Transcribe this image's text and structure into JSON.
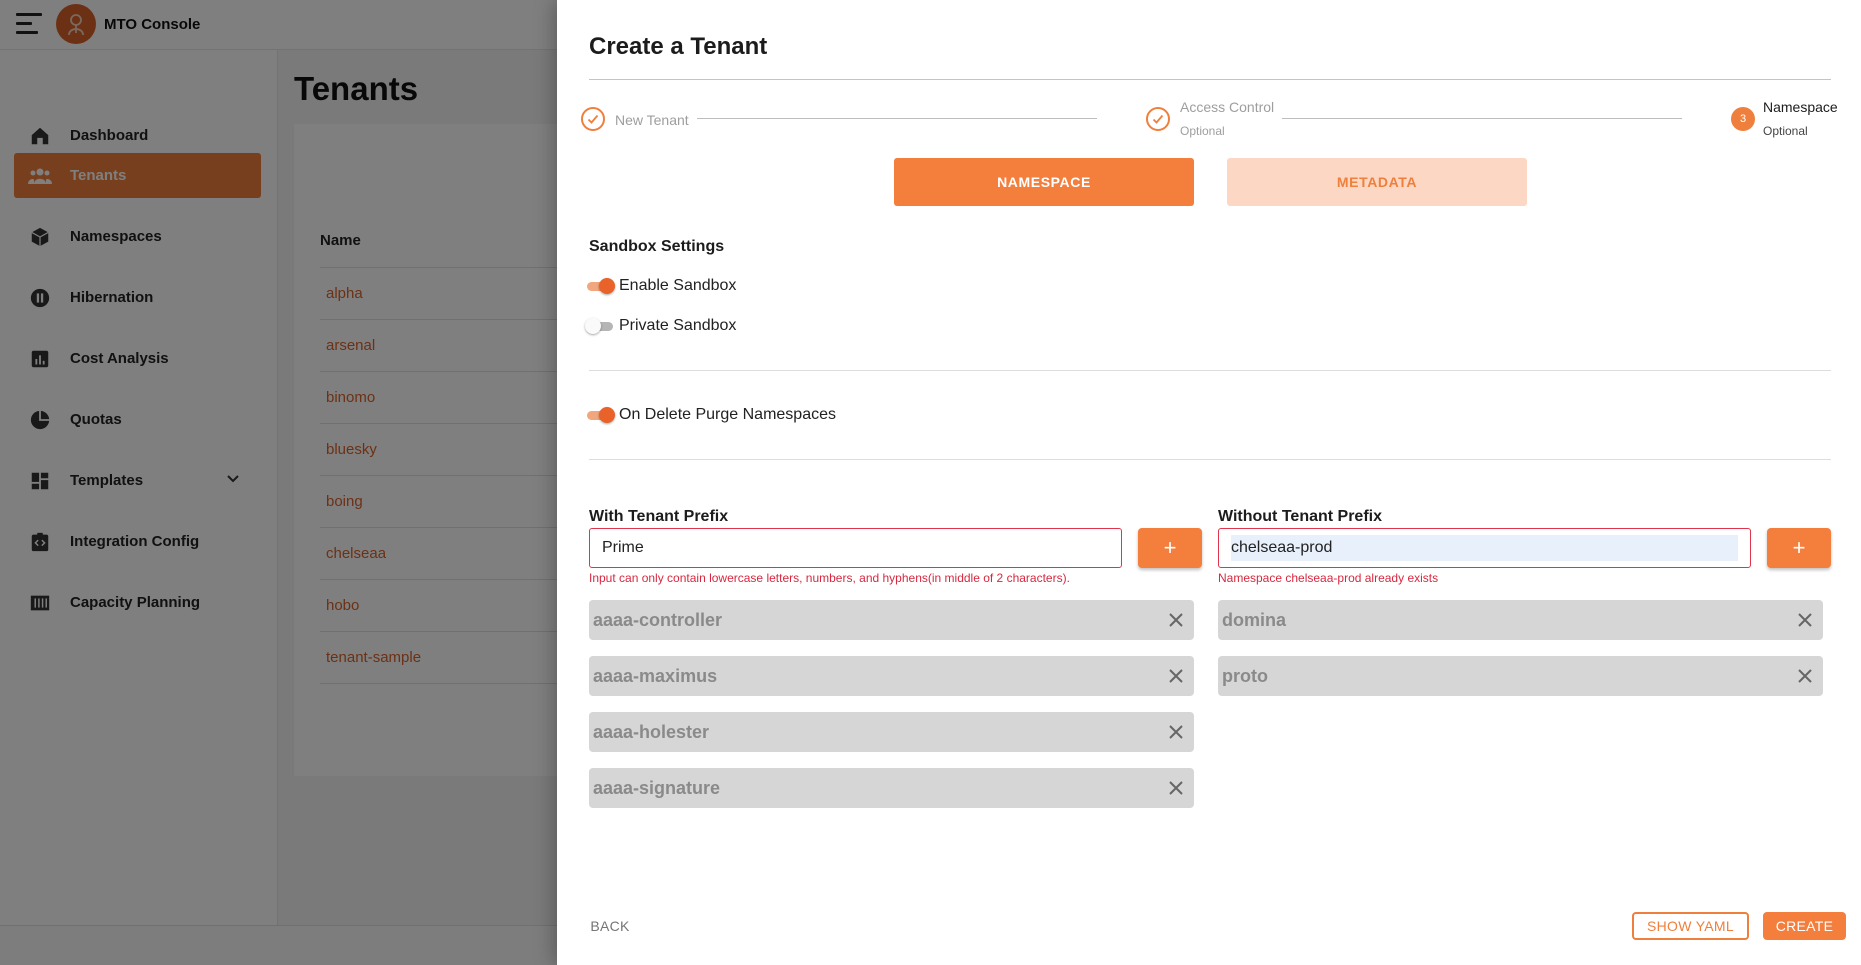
{
  "app": {
    "title": "MTO Console",
    "page_title": "Tenants",
    "sidebar": {
      "items": [
        {
          "label": "Dashboard",
          "icon": "home-icon"
        },
        {
          "label": "Tenants",
          "icon": "people-icon",
          "active": true
        },
        {
          "label": "Namespaces",
          "icon": "cube-icon"
        },
        {
          "label": "Hibernation",
          "icon": "pause-icon"
        },
        {
          "label": "Cost Analysis",
          "icon": "bar-chart-icon"
        },
        {
          "label": "Quotas",
          "icon": "pie-chart-icon"
        },
        {
          "label": "Templates",
          "icon": "dashboard-icon",
          "expandable": true
        },
        {
          "label": "Integration Config",
          "icon": "code-clipboard-icon"
        },
        {
          "label": "Capacity Planning",
          "icon": "columns-icon"
        }
      ]
    },
    "table": {
      "column_name": "Name",
      "rows": [
        "alpha",
        "arsenal",
        "binomo",
        "bluesky",
        "boing",
        "chelseaa",
        "hobo",
        "tenant-sample"
      ]
    }
  },
  "drawer": {
    "title": "Create a Tenant",
    "steps": [
      {
        "label": "New Tenant",
        "state": "done"
      },
      {
        "label": "Access Control",
        "sub": "Optional",
        "state": "done"
      },
      {
        "label": "Namespace",
        "sub": "Optional",
        "state": "active",
        "number": "3"
      }
    ],
    "tabs": {
      "namespace": "NAMESPACE",
      "metadata": "METADATA"
    },
    "sandbox": {
      "title": "Sandbox Settings",
      "enable_label": "Enable Sandbox",
      "enable_on": true,
      "private_label": "Private Sandbox",
      "private_on": false
    },
    "purge": {
      "label": "On Delete Purge Namespaces",
      "on": true
    },
    "with_prefix": {
      "label": "With Tenant Prefix",
      "value": "Prime",
      "error": "Input can only contain lowercase letters, numbers, and hyphens(in middle of 2 characters).",
      "add_label": "+",
      "items": [
        "aaaa-controller",
        "aaaa-maximus",
        "aaaa-holester",
        "aaaa-signature"
      ]
    },
    "without_prefix": {
      "label": "Without Tenant Prefix",
      "value": "chelseaa-prod",
      "error": "Namespace chelseaa-prod already exists",
      "add_label": "+",
      "items": [
        "domina",
        "proto"
      ]
    },
    "footer": {
      "back": "BACK",
      "show_yaml": "SHOW YAML",
      "create": "CREATE"
    }
  },
  "colors": {
    "accent": "#f47e3c",
    "error": "#d8283f",
    "chip_bg": "#d6d6d6"
  }
}
